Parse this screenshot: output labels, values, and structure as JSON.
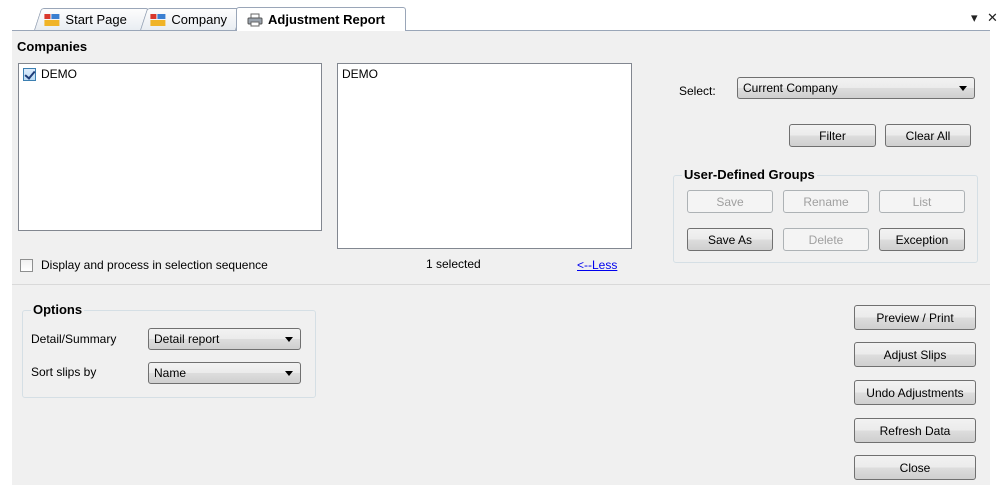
{
  "tabs": [
    {
      "label": "Start Page",
      "icon": "app-icon"
    },
    {
      "label": "Company",
      "icon": "app-icon"
    },
    {
      "label": "Adjustment Report",
      "icon": "printer-icon",
      "active": true
    }
  ],
  "tab_controls": {
    "dropdown": "▾",
    "close": "✕"
  },
  "companies": {
    "title": "Companies",
    "available": [
      {
        "label": "DEMO",
        "checked": true
      }
    ],
    "selected_list": [
      "DEMO"
    ],
    "selected_count": "1 selected",
    "less_link": "<--Less",
    "sequence_label": "Display and process in selection sequence",
    "sequence_checked": false
  },
  "selection": {
    "select_label": "Select:",
    "select_value": "Current Company",
    "filter_button": "Filter",
    "clear_all_button": "Clear All"
  },
  "user_groups": {
    "title": "User-Defined Groups",
    "save": "Save",
    "rename": "Rename",
    "list": "List",
    "save_as": "Save As",
    "delete": "Delete",
    "exception": "Exception"
  },
  "options": {
    "title": "Options",
    "detail_label": "Detail/Summary",
    "detail_value": "Detail report",
    "sort_label": "Sort slips by",
    "sort_value": "Name"
  },
  "actions": {
    "preview_print": "Preview / Print",
    "adjust_slips": "Adjust Slips",
    "undo_adjustments": "Undo Adjustments",
    "refresh_data": "Refresh Data",
    "close": "Close"
  }
}
